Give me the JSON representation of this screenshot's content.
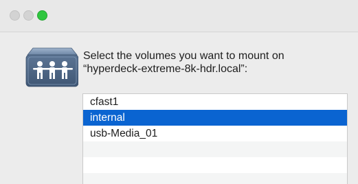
{
  "window": {
    "title_buttons": [
      "close",
      "minimize",
      "zoom"
    ],
    "icon": "network-share-users-icon"
  },
  "prompt": {
    "line1": "Select the volumes you want to mount on",
    "line2": "“hyperdeck-extreme-8k-hdr.local”:"
  },
  "volumes": {
    "items": [
      {
        "label": "cfast1",
        "selected": false
      },
      {
        "label": "internal",
        "selected": true
      },
      {
        "label": "usb-Media_01",
        "selected": false
      }
    ]
  },
  "colors": {
    "selection": "#0a64d1",
    "zoom_button": "#2fc63f"
  }
}
